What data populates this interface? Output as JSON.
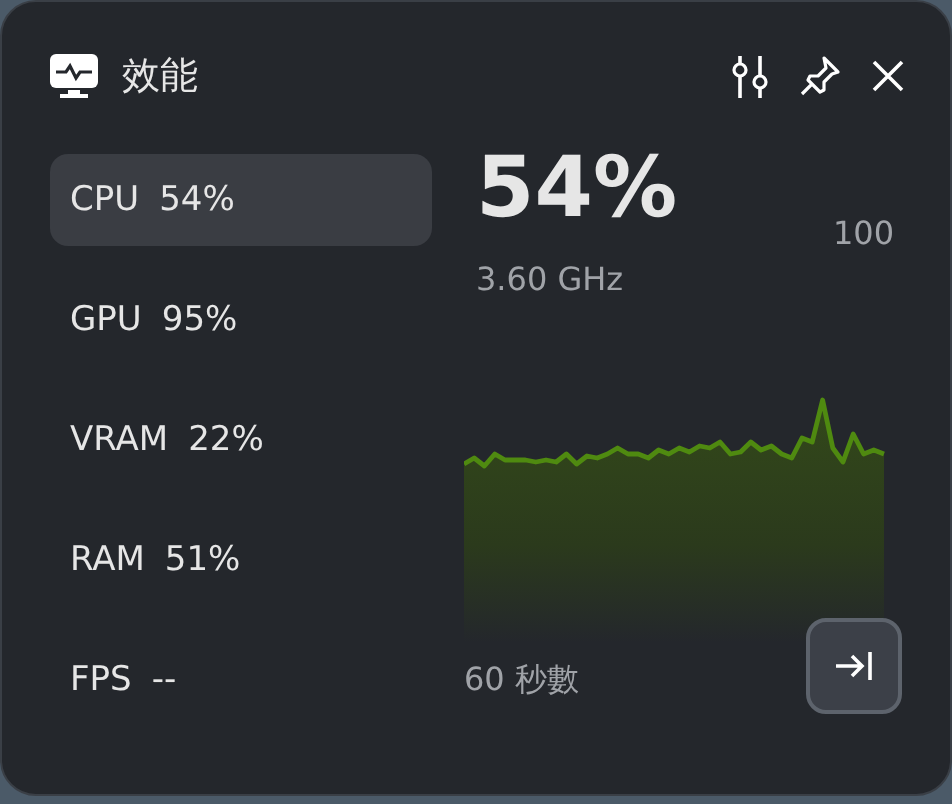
{
  "window": {
    "title": "效能"
  },
  "metrics": [
    {
      "label": "CPU",
      "value": "54%",
      "selected": true
    },
    {
      "label": "GPU",
      "value": "95%",
      "selected": false
    },
    {
      "label": "VRAM",
      "value": "22%",
      "selected": false
    },
    {
      "label": "RAM",
      "value": "51%",
      "selected": false
    },
    {
      "label": "FPS",
      "value": "--",
      "selected": false
    }
  ],
  "detail": {
    "value": "54%",
    "max": "100",
    "frequency": "3.60 GHz",
    "time_span": "60 秒數"
  }
}
